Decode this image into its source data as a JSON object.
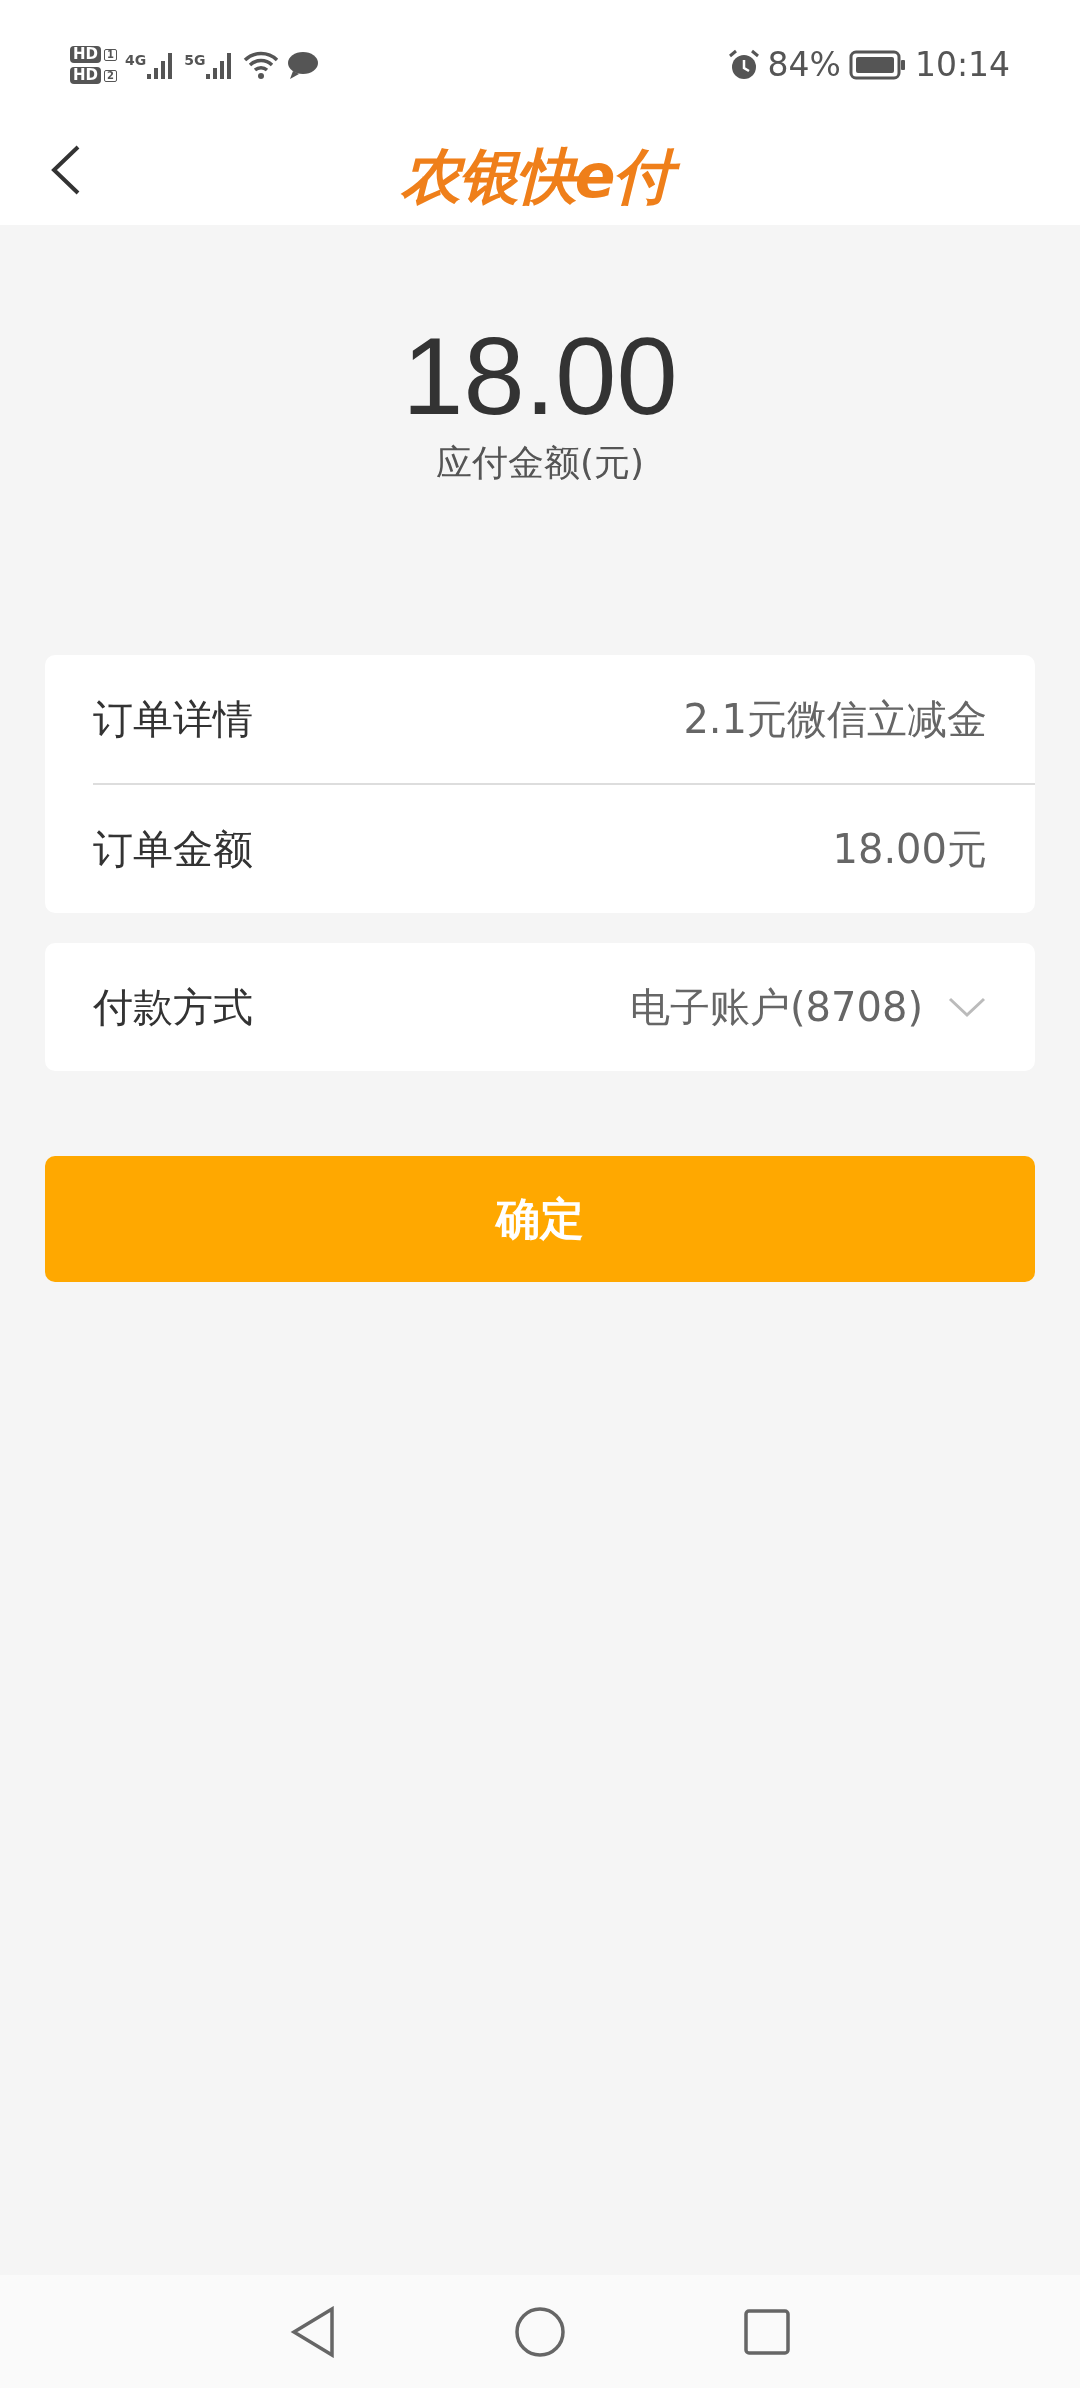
{
  "status_bar": {
    "sims": [
      {
        "hd": "HD",
        "slot": "1"
      },
      {
        "hd": "HD",
        "slot": "2"
      }
    ],
    "networks": [
      "4G",
      "5G"
    ],
    "battery": "84%",
    "time": "10:14"
  },
  "header": {
    "logo": "农银快e付"
  },
  "amount": {
    "value": "18.00",
    "label": "应付金额(元)"
  },
  "order_rows": [
    {
      "label": "订单详情",
      "value": "2.1元微信立减金"
    },
    {
      "label": "订单金额",
      "value": "18.00元"
    }
  ],
  "payment": {
    "label": "付款方式",
    "value": "电子账户(8708)",
    "expanded": false
  },
  "confirm_button": "确定"
}
